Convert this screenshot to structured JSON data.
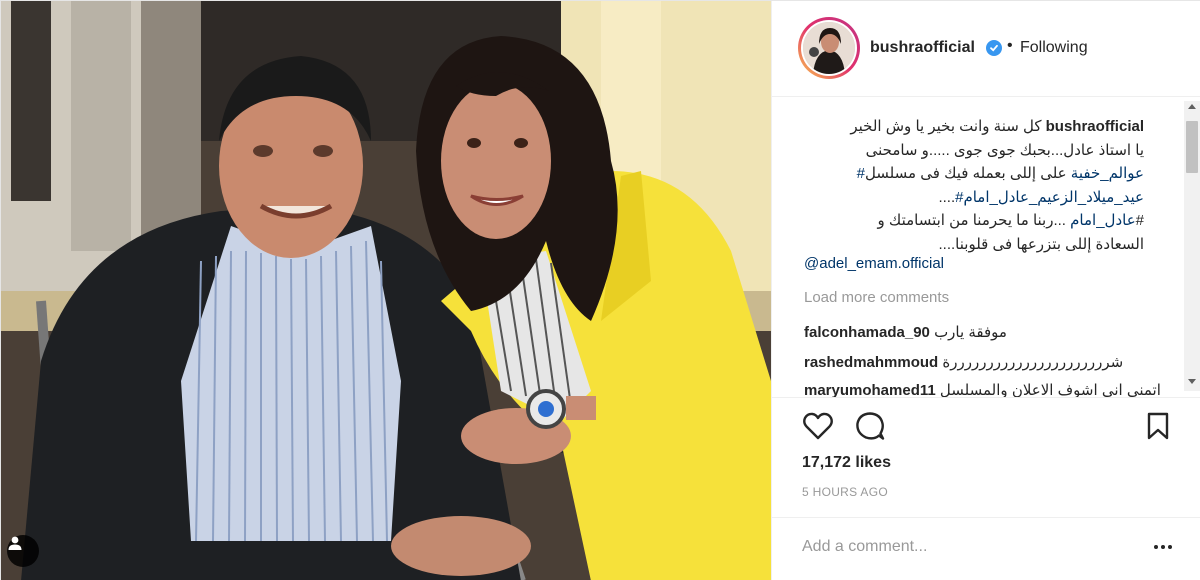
{
  "post": {
    "image_alt": "Photo of an older man in a dark jacket and striped shirt seated beside a woman in a yellow blazer, both smiling",
    "tag_icon": "user-tag-icon"
  },
  "header": {
    "username": "bushraofficial",
    "verified_icon": "verified-badge-icon",
    "separator": "•",
    "follow_status": "Following"
  },
  "caption": {
    "username": "bushraofficial",
    "line1_text": "كل سنة وانت بخير يا وش الخير",
    "line2": "يا استاذ عادل...بحبك جوى جوى .....و سامحنى",
    "line3_text": "على إللى بعمله فيك فى مسلسل",
    "line3_hashtag": "#عوالم_خفية",
    "line4_dots": "....",
    "line4_hashtag": "#عيد_ميلاد_الزعيم_عادل_امام",
    "line5_hashtag": "عادل_امام",
    "line5_text": " ...ربنا ما يحرمنا من ابتسامتك و#",
    "line6": "....السعادة إللى بتزرعها فى قلوبنا",
    "mention": "@adel_emam.official"
  },
  "load_more": "Load more comments",
  "comments": [
    {
      "user": "falconhamada_90",
      "text": "موفقة يارب"
    },
    {
      "user": "rashedmahmmoud",
      "text": "شررررررررررررررررررررررة"
    },
    {
      "user": "maryumohamed11",
      "text": "اتمنى انى اشوف الاعلان والمسلسل"
    }
  ],
  "actions": {
    "like_icon": "heart-icon",
    "comment_icon": "speech-bubble-icon",
    "save_icon": "bookmark-icon",
    "likes": "17,172 likes",
    "timestamp": "5 HOURS AGO"
  },
  "add_comment": {
    "placeholder": "Add a comment...",
    "more_icon": "ellipsis-icon"
  },
  "colors": {
    "link": "#003569",
    "verified": "#3897f0",
    "muted": "#999999",
    "text": "#262626"
  }
}
